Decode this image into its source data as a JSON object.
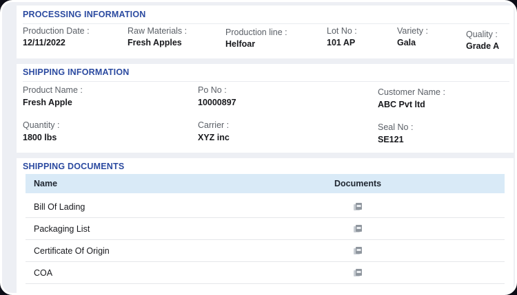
{
  "page": {
    "accent_color": "#2b4aa0",
    "table_header_bg": "#d9eaf7",
    "card_bg": "#ffffff",
    "page_bg": "#edeff4"
  },
  "processing": {
    "title": "PROCESSING INFORMATION",
    "fields": [
      {
        "label": "Production Date :",
        "value": "12/11/2022"
      },
      {
        "label": "Raw Materials :",
        "value": "Fresh Apples"
      },
      {
        "label": "Production line :",
        "value": "Helfoar"
      },
      {
        "label": "Lot No :",
        "value": "101 AP"
      },
      {
        "label": "Variety :",
        "value": "Gala"
      },
      {
        "label": "Quality :",
        "value": "Grade A"
      }
    ]
  },
  "shipping": {
    "title": "SHIPPING INFORMATION",
    "fields": [
      {
        "label": "Product Name :",
        "value": "Fresh Apple"
      },
      {
        "label": "Po No :",
        "value": "10000897"
      },
      {
        "label": "Customer Name :",
        "value": "ABC Pvt ltd"
      },
      {
        "label": "Quantity :",
        "value": "1800 lbs"
      },
      {
        "label": "Carrier :",
        "value": "XYZ inc"
      },
      {
        "label": "Seal No :",
        "value": "SE121"
      }
    ]
  },
  "documents": {
    "title": "SHIPPING DOCUMENTS",
    "columns": {
      "name": "Name",
      "documents": "Documents"
    },
    "rows": [
      {
        "name": "Bill Of Lading"
      },
      {
        "name": "Packaging List"
      },
      {
        "name": "Certificate Of Origin"
      },
      {
        "name": "COA"
      }
    ],
    "icon": "pdf-file-icon",
    "icon_color": "#8f969e"
  }
}
